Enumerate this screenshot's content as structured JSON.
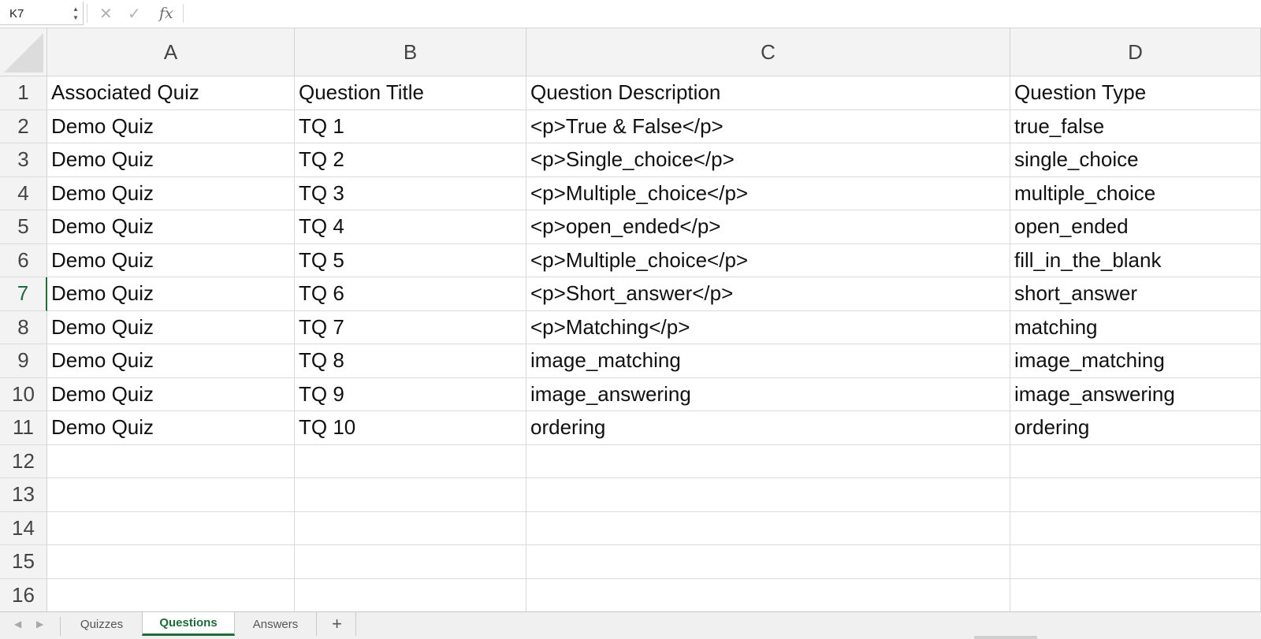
{
  "formula_bar": {
    "name_box": "K7",
    "stepper_up": "▲",
    "stepper_down": "▼",
    "cancel_glyph": "✕",
    "confirm_glyph": "✓",
    "fx_label": "fx",
    "formula": ""
  },
  "columns": [
    "A",
    "B",
    "C",
    "D"
  ],
  "rows": [
    "1",
    "2",
    "3",
    "4",
    "5",
    "6",
    "7",
    "8",
    "9",
    "10",
    "11",
    "12",
    "13",
    "14",
    "15",
    "16"
  ],
  "active_row": "7",
  "cells": [
    [
      "Associated Quiz",
      "Question Title",
      "Question Description",
      "Question Type"
    ],
    [
      "Demo Quiz",
      "TQ 1",
      "<p>True & False</p>",
      "true_false"
    ],
    [
      "Demo Quiz",
      "TQ 2",
      "<p>Single_choice</p>",
      "single_choice"
    ],
    [
      "Demo Quiz",
      "TQ 3",
      "<p>Multiple_choice</p>",
      "multiple_choice"
    ],
    [
      "Demo Quiz",
      "TQ 4",
      "<p>open_ended</p>",
      "open_ended"
    ],
    [
      "Demo Quiz",
      "TQ 5",
      "<p>Multiple_choice</p>",
      "fill_in_the_blank"
    ],
    [
      "Demo Quiz",
      "TQ 6",
      "<p>Short_answer</p>",
      "short_answer"
    ],
    [
      "Demo Quiz",
      "TQ 7",
      "<p>Matching</p>",
      "matching"
    ],
    [
      "Demo Quiz",
      "TQ 8",
      "image_matching",
      "image_matching"
    ],
    [
      "Demo Quiz",
      "TQ 9",
      "image_answering",
      "image_answering"
    ],
    [
      "Demo Quiz",
      "TQ 10",
      "ordering",
      "ordering"
    ],
    [
      "",
      "",
      "",
      ""
    ],
    [
      "",
      "",
      "",
      ""
    ],
    [
      "",
      "",
      "",
      ""
    ],
    [
      "",
      "",
      "",
      ""
    ],
    [
      "",
      "",
      "",
      ""
    ]
  ],
  "sheet_tabs": {
    "nav_prev": "◀",
    "nav_next": "▶",
    "tabs": [
      "Quizzes",
      "Questions",
      "Answers"
    ],
    "active": "Questions",
    "add_label": "+"
  },
  "colors": {
    "accent": "#1f6b39",
    "header_bg": "#f3f3f3",
    "gridline": "#dadada"
  }
}
